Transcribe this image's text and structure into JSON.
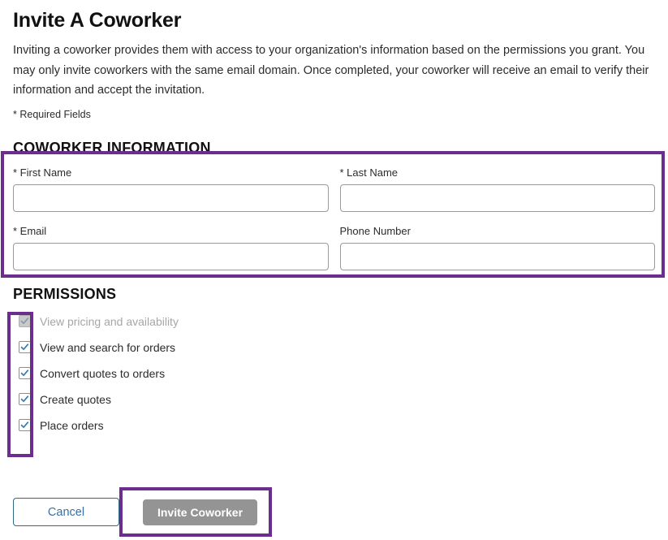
{
  "header": {
    "title": "Invite A Coworker",
    "intro": "Inviting a coworker provides them with access to your organization's information based on the permissions you grant. You may only invite coworkers with the same email domain. Once completed, your coworker will receive an email to verify their information and accept the invitation.",
    "required_note": "* Required Fields"
  },
  "coworker_section": {
    "heading": "COWORKER INFORMATION",
    "fields": [
      {
        "label": "* First Name",
        "value": "",
        "placeholder": ""
      },
      {
        "label": "* Last Name",
        "value": "",
        "placeholder": ""
      },
      {
        "label": "* Email",
        "value": "",
        "placeholder": ""
      },
      {
        "label": "Phone Number",
        "value": "",
        "placeholder": ""
      }
    ]
  },
  "permissions_section": {
    "heading": "PERMISSIONS",
    "items": [
      {
        "label": "View pricing and availability",
        "checked": true,
        "disabled": true
      },
      {
        "label": "View and search for orders",
        "checked": true,
        "disabled": false
      },
      {
        "label": "Convert quotes to orders",
        "checked": true,
        "disabled": false
      },
      {
        "label": "Create quotes",
        "checked": true,
        "disabled": false
      },
      {
        "label": "Place orders",
        "checked": true,
        "disabled": false
      }
    ]
  },
  "footer": {
    "cancel_label": "Cancel",
    "invite_label": "Invite Coworker"
  },
  "colors": {
    "annotation_purple": "#6b2e8f",
    "checkbox_check": "#3c78b4",
    "cancel_text": "#3a6ea8",
    "cancel_border": "#2f6a86",
    "invite_background": "#949494",
    "disabled_text": "#a6a6a6"
  }
}
